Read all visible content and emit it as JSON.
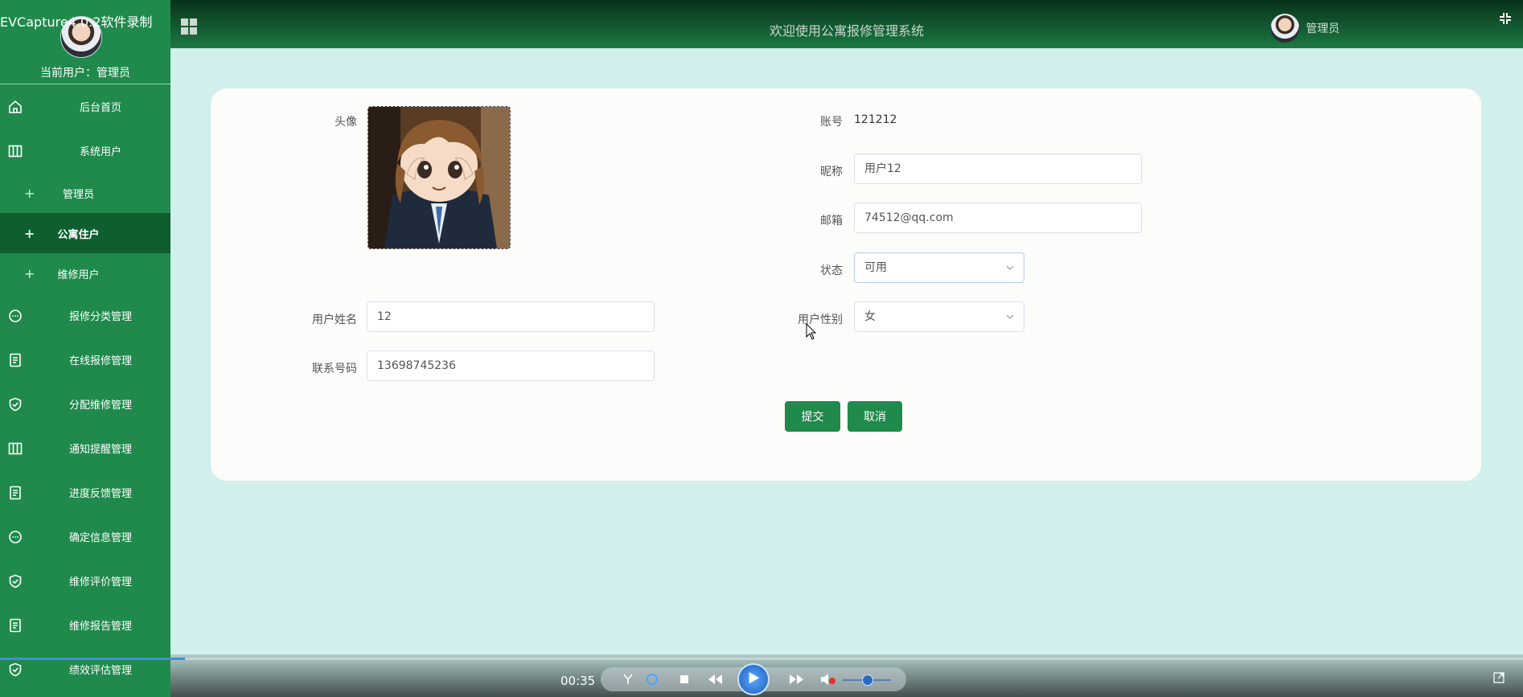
{
  "watermark": "EVCapture4.0.2软件录制",
  "sidebar": {
    "current_user": "当前用户：管理员",
    "items": [
      {
        "label": "后台首页",
        "icon": "home-icon"
      },
      {
        "label": "系统用户",
        "icon": "columns-icon"
      },
      {
        "label": "管理员",
        "icon": "plus-icon",
        "sub": true
      },
      {
        "label": "公寓住户",
        "icon": "plus-icon",
        "sub": true,
        "active": true
      },
      {
        "label": "维修用户",
        "icon": "plus-icon",
        "sub": true
      },
      {
        "label": "报修分类管理",
        "icon": "chat-icon"
      },
      {
        "label": "在线报修管理",
        "icon": "document-icon"
      },
      {
        "label": "分配维修管理",
        "icon": "shield-check-icon"
      },
      {
        "label": "通知提醒管理",
        "icon": "columns-icon"
      },
      {
        "label": "进度反馈管理",
        "icon": "document-icon"
      },
      {
        "label": "确定信息管理",
        "icon": "chat-icon"
      },
      {
        "label": "维修评价管理",
        "icon": "shield-check-icon"
      },
      {
        "label": "维修报告管理",
        "icon": "document-icon"
      },
      {
        "label": "绩效评估管理",
        "icon": "shield-check-icon"
      }
    ]
  },
  "header": {
    "title": "欢迎使用公寓报修管理系统",
    "username": "管理员"
  },
  "form": {
    "avatar_label": "头像",
    "account_label": "账号",
    "account_value": "121212",
    "nickname_label": "昵称",
    "nickname_value": "用户12",
    "email_label": "邮箱",
    "email_value": "74512@qq.com",
    "status_label": "状态",
    "status_value": "可用",
    "name_label": "用户姓名",
    "name_value": "12",
    "gender_label": "用户性别",
    "gender_value": "女",
    "phone_label": "联系号码",
    "phone_value": "13698745236",
    "submit_label": "提交",
    "cancel_label": "取消"
  },
  "player": {
    "time": "00:35"
  },
  "colors": {
    "sidebar": "#1f8a4c",
    "sidebar_active": "#0e5e2f",
    "page_bg": "#d0efed",
    "button": "#1f8a4c"
  }
}
